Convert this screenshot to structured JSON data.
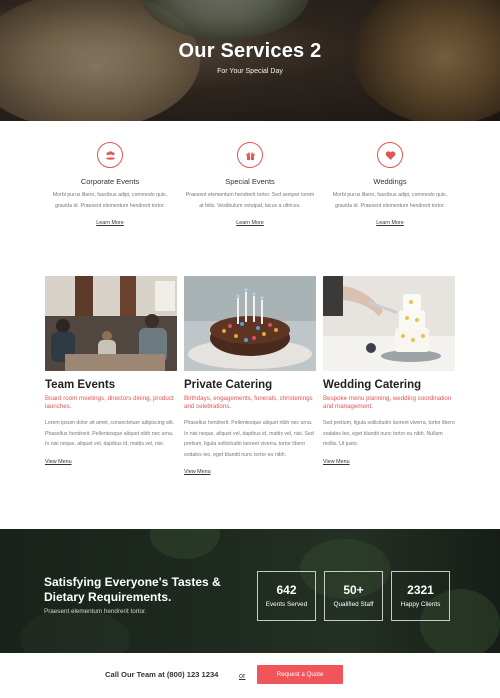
{
  "hero": {
    "title": "Our Services 2",
    "subtitle": "For Your Special Day"
  },
  "services": [
    {
      "icon": "people-group-icon",
      "name": "Corporate Events",
      "description": "Morbi purus libero, faucibus adipi, commodo quis, gravida id. Praesent elementum hendrerit tortor.",
      "link": "Learn More"
    },
    {
      "icon": "gift-icon",
      "name": "Special Events",
      "description": "Praesent elementum hendrerit tortor. Sed semper lorem at felis. Vestibulum volutpat, lacus a ultrices.",
      "link": "Learn More"
    },
    {
      "icon": "heart-icon",
      "name": "Weddings",
      "description": "Morbi purus libero, faucibus adipi, commodo quis, gravida id. Praesent elementum hendrerit tortor.",
      "link": "Learn More"
    }
  ],
  "cards": [
    {
      "title": "Team Events",
      "tagline": "Board room meetings, directors dining, product launches.",
      "body": "Lorem ipsum dolor sit amet, consectetuer adipiscing elit. Phasellus hendrerit. Pellentesque aliquet nibh nec urna. In nisi neque, aliquet vel, dapibus id, mattis vel, nisi.",
      "link": "View Menu"
    },
    {
      "title": "Private Catering",
      "tagline": "Birthdays, engagements, funerals, christenings and celebrations.",
      "body": "Phasellus hendrerit. Pellentesque aliquet nibh nec urna. In nisi neque, aliquet vel, dapibus id, mattis vel, nisi. Sed pretium, ligula sollicitudin laoreet viverra, tortor libero sodales leo, eget blandit nunc tortor eu nibh.",
      "link": "View Menu"
    },
    {
      "title": "Wedding Catering",
      "tagline": "Bespoke menu planning, wedding coordination and management.",
      "body": "Sed pretium, ligula sollicitudin laoreet viverra, tortor libero sodales leo, eget blandit nunc tortor eu nibh. Nullam mollis. Ut justo.",
      "link": "View Menu"
    }
  ],
  "stats_band": {
    "title": "Satisfying Everyone's Tastes & Dietary Requirements.",
    "subtitle": "Praesent elementum hendrerit tortor.",
    "stats": [
      {
        "number": "642",
        "label": "Events Served"
      },
      {
        "number": "50+",
        "label": "Qualified Staff"
      },
      {
        "number": "2321",
        "label": "Happy Clients"
      }
    ]
  },
  "cta": {
    "call_text": "Call Our Team at (800) 123 1234",
    "or_text": "or",
    "button_label": "Request a Quote"
  },
  "colors": {
    "accent": "#f0555a",
    "text": "#333333",
    "muted": "#777777"
  }
}
